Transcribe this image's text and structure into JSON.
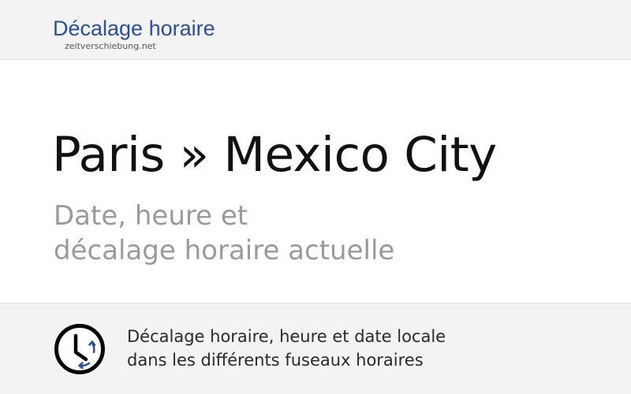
{
  "header": {
    "brand_title": "Décalage horaire",
    "brand_domain": "zeitverschiebung.net"
  },
  "hero": {
    "title": "Paris » Mexico City",
    "subtitle_line1": "Date, heure et",
    "subtitle_line2": "décalage horaire actuelle"
  },
  "footer": {
    "icon": "clock-icon",
    "text_line1": "Décalage horaire, heure et date locale",
    "text_line2": "dans les différents fuseaux horaires"
  },
  "colors": {
    "brand": "#2c4f9c",
    "title": "#111111",
    "subtitle": "#9a9a9a",
    "band_background": "#f3f3f3"
  }
}
